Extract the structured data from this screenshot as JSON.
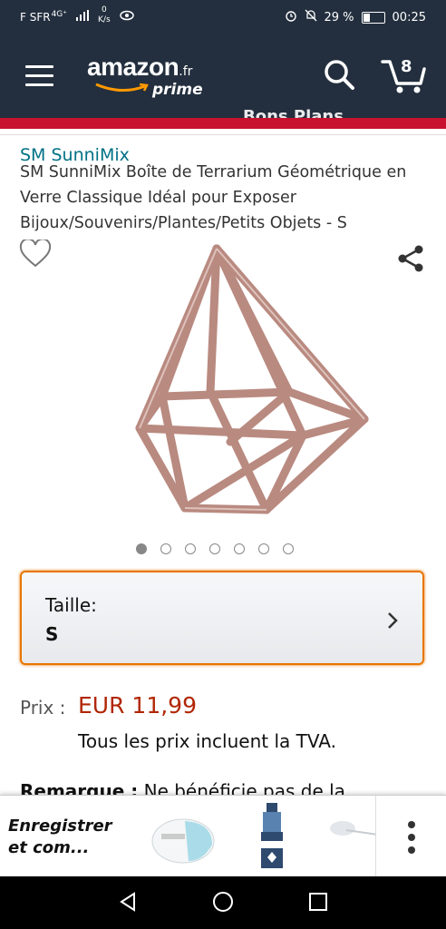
{
  "status_bar": {
    "carrier": "F SFR",
    "network": "4G⁺",
    "speed_value": "0",
    "speed_unit": "K/s",
    "battery": "29 %",
    "time": "00:25"
  },
  "header": {
    "logo_text": "amazon",
    "logo_suffix": ".fr",
    "logo_prime": "prime",
    "cart_count": "8"
  },
  "product": {
    "banner_text_partial": "Bons Plans",
    "brand": "SM SunniMix",
    "title": "SM SunniMix Boîte de Terrarium Géométrique en Verre Classique Idéal pour Exposer Bijoux/Souvenirs/Plantes/Petits Objets - S",
    "image_count": 7,
    "active_image": 1
  },
  "size_selector": {
    "label": "Taille:",
    "value": "S"
  },
  "pricing": {
    "label": "Prix :",
    "price": "EUR 11,99",
    "tax_note": "Tous les prix incluent la TVA."
  },
  "remark": {
    "label": "Remarque :",
    "text": "Ne bénéficie pas de la"
  },
  "saved_bar": {
    "text": "Enregistrer et com..."
  },
  "colors": {
    "header_bg": "#232f3e",
    "accent_red": "#c6122e",
    "brand_link": "#007185",
    "price": "#b12704",
    "focus_orange": "#e77600"
  }
}
